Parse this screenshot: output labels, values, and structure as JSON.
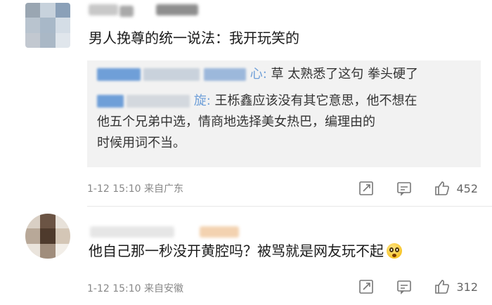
{
  "comments": [
    {
      "text": "男人挽尊的统一说法：我开玩笑的",
      "replies": [
        {
          "name_suffix": "心:",
          "text": "草 太熟悉了这句 拳头硬了"
        },
        {
          "name_suffix": "旋:",
          "text_line1": "王栎鑫应该没有其它意思，他不想在",
          "text_line2": "他五个兄弟中选，情商地选择美女热巴，编理由的",
          "text_line3": "时候用词不当。"
        }
      ],
      "time": "1-12 15:10",
      "location": "来自广东",
      "likes": "452"
    },
    {
      "text": "他自己那一秒没开黄腔吗？被骂就是网友玩不起",
      "emoji": "flushed-face-emoji",
      "time": "1-12 15:10",
      "location": "来自安徽",
      "likes": "312"
    }
  ],
  "icons": {
    "share": "share-icon",
    "comment": "comment-icon",
    "like": "thumbs-up-icon"
  },
  "colors": {
    "meta_text": "#888888",
    "reply_bg": "#f2f2f2",
    "blur_blue": "#6f9fd8"
  }
}
